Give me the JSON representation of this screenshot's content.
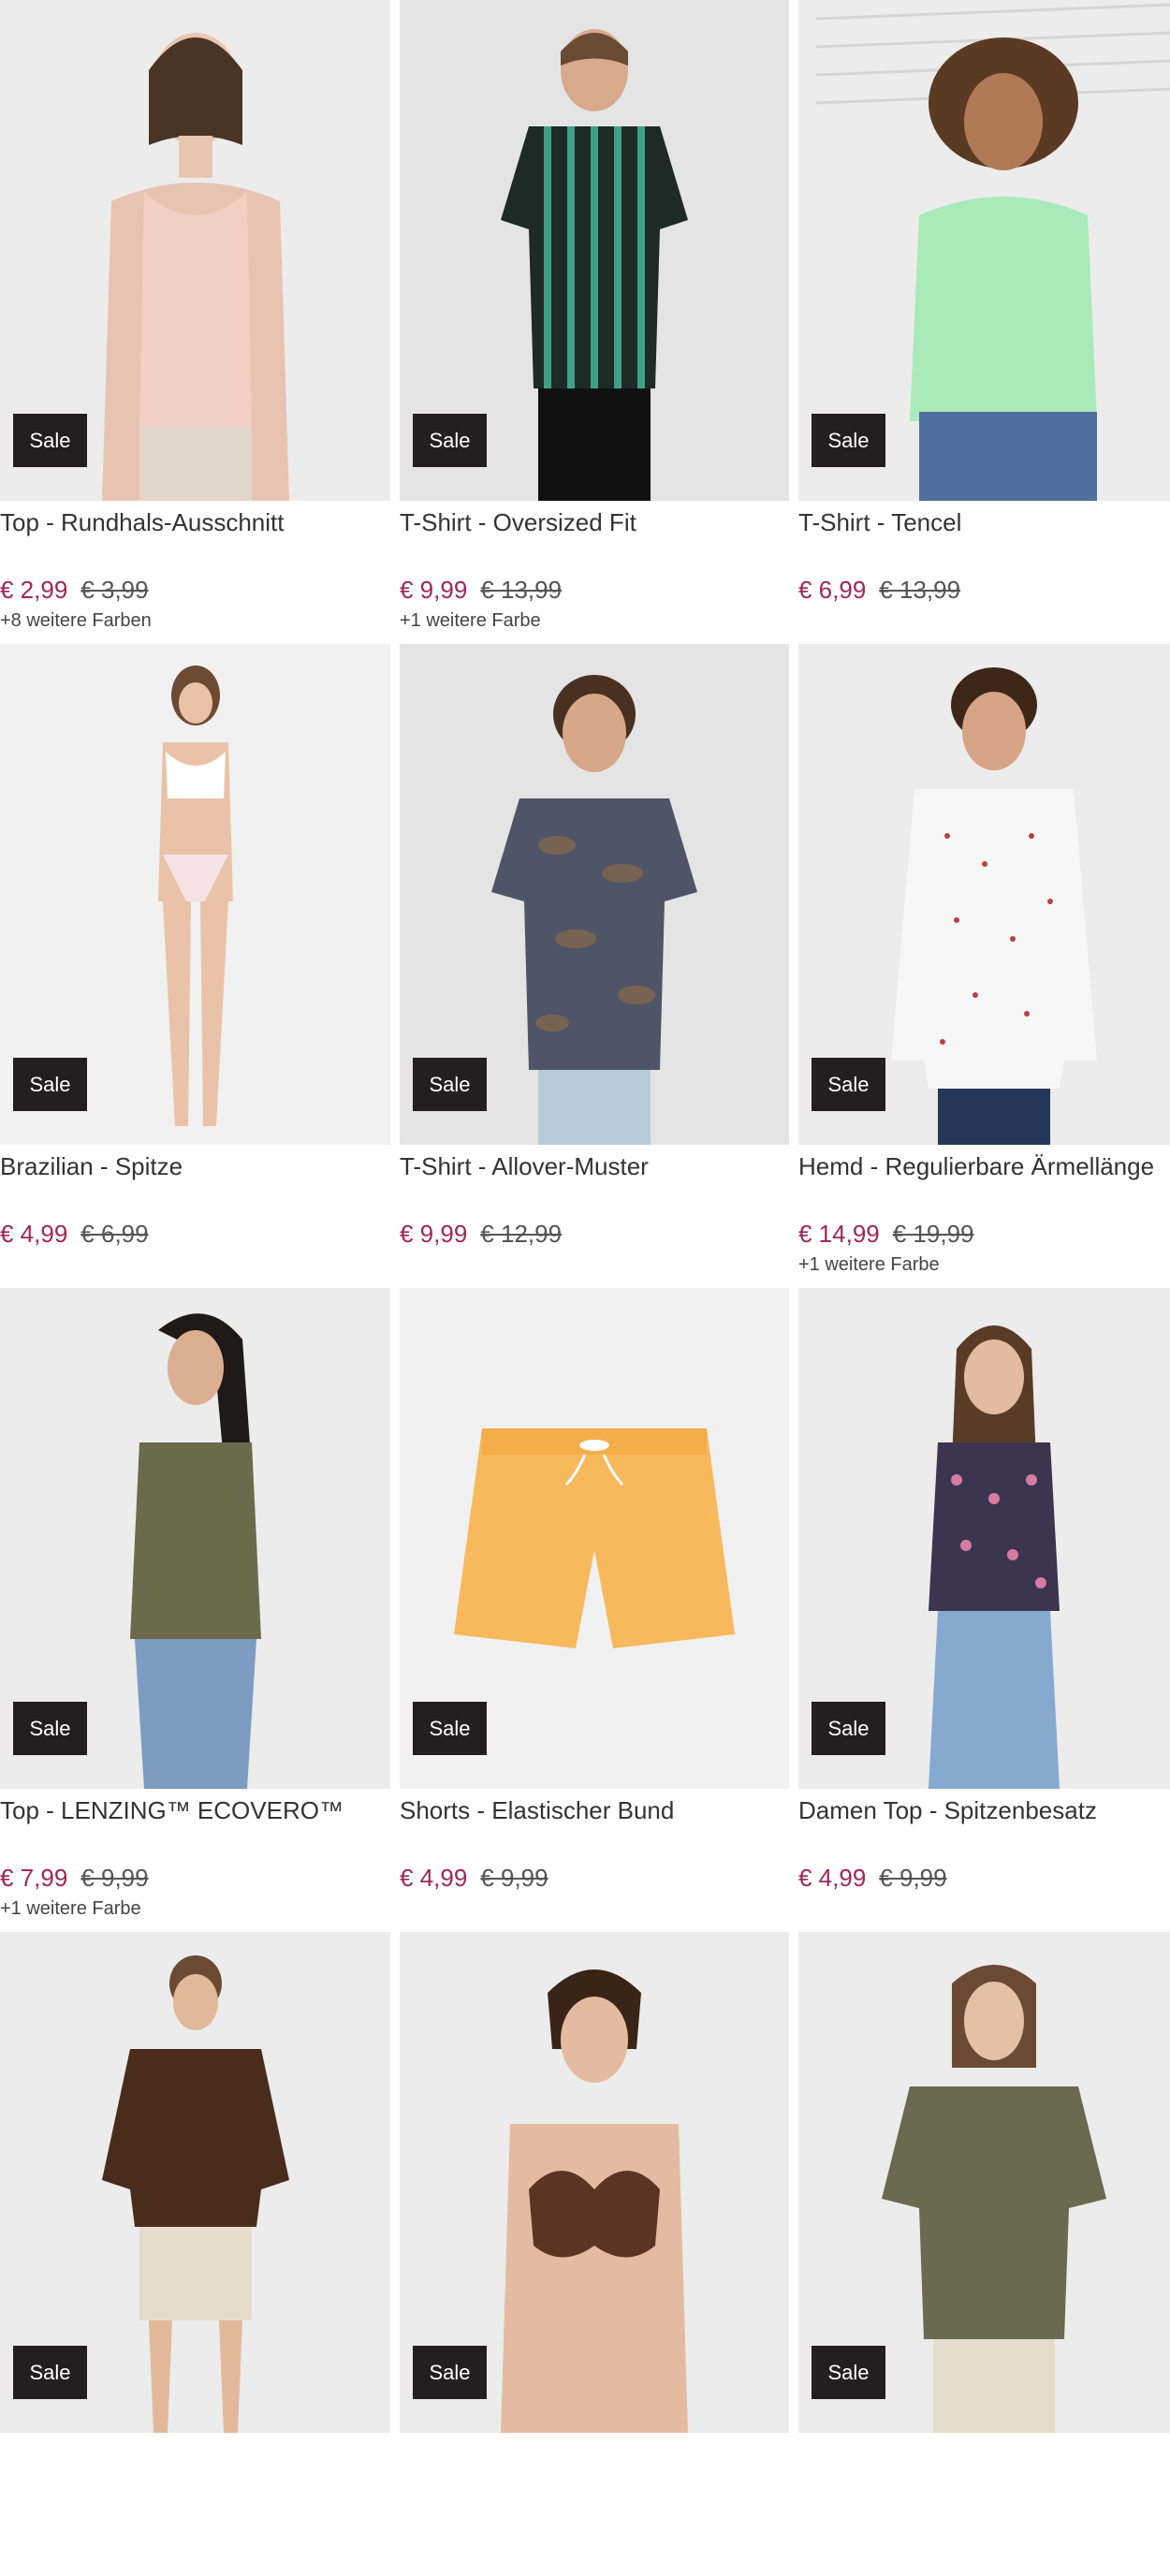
{
  "sale_label": "Sale",
  "products": [
    {
      "name": "Top - Rundhals-Ausschnitt",
      "price": "€ 2,99",
      "old_price": "€ 3,99",
      "colors": "+8 weitere Farben"
    },
    {
      "name": "T-Shirt - Oversized Fit",
      "price": "€ 9,99",
      "old_price": "€ 13,99",
      "colors": "+1 weitere Farbe"
    },
    {
      "name": "T-Shirt - Tencel",
      "price": "€ 6,99",
      "old_price": "€ 13,99",
      "colors": ""
    },
    {
      "name": "Brazilian - Spitze",
      "price": "€ 4,99",
      "old_price": "€ 6,99",
      "colors": ""
    },
    {
      "name": "T-Shirt - Allover-Muster",
      "price": "€ 9,99",
      "old_price": "€ 12,99",
      "colors": ""
    },
    {
      "name": "Hemd - Regulierbare Ärmellänge",
      "price": "€ 14,99",
      "old_price": "€ 19,99",
      "colors": "+1 weitere Farbe"
    },
    {
      "name": "Top - LENZING™ ECOVERO™",
      "price": "€ 7,99",
      "old_price": "€ 9,99",
      "colors": "+1 weitere Farbe"
    },
    {
      "name": "Shorts - Elastischer Bund",
      "price": "€ 4,99",
      "old_price": "€ 9,99",
      "colors": ""
    },
    {
      "name": "Damen Top - Spitzenbesatz",
      "price": "€ 4,99",
      "old_price": "€ 9,99",
      "colors": ""
    },
    {
      "name": "",
      "price": "",
      "old_price": "",
      "colors": ""
    },
    {
      "name": "",
      "price": "",
      "old_price": "",
      "colors": ""
    },
    {
      "name": "",
      "price": "",
      "old_price": "",
      "colors": ""
    }
  ],
  "colors": {
    "price_accent": "#a0265a",
    "badge_bg": "#231f20"
  }
}
